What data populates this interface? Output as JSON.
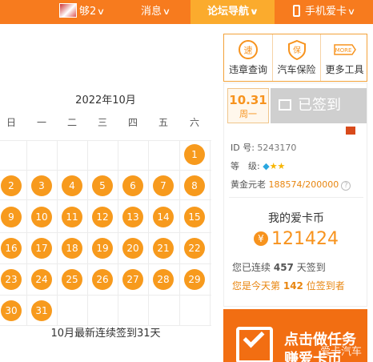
{
  "topnav": {
    "user_label": "够2",
    "messages_label": "消息",
    "forum_nav_label": "论坛导航",
    "mobile_label": "手机爱卡"
  },
  "tools": [
    {
      "icon": "speed-camera-icon",
      "label": "违章查询",
      "glyph": "速"
    },
    {
      "icon": "insurance-icon",
      "label": "汽车保险",
      "glyph": "保"
    },
    {
      "icon": "more-icon",
      "label": "更多工具",
      "glyph": "MORE"
    }
  ],
  "calendar": {
    "title": "2022年10月",
    "weekdays": [
      "日",
      "一",
      "二",
      "三",
      "四",
      "五",
      "六"
    ],
    "signed_days": [
      "1",
      "2",
      "3",
      "4",
      "5",
      "6",
      "7",
      "8",
      "9",
      "10",
      "11",
      "12",
      "13",
      "14",
      "15",
      "16",
      "17",
      "18",
      "19",
      "20",
      "21",
      "22",
      "23",
      "24",
      "25",
      "26",
      "27",
      "28",
      "29",
      "30",
      "31"
    ],
    "footer": "10月最新连续签到31天"
  },
  "sign_panel": {
    "date": "10.31",
    "weekday": "周一",
    "signed_label": "已签到",
    "id_label": "ID 号:",
    "id_value": "5243170",
    "level_label": "等　级:",
    "gold_label": "黄金元老",
    "gold_value": "188574/200000",
    "coin_title": "我的爱卡币",
    "coin_value": "121424",
    "coin_symbol": "¥",
    "streak_prefix": "您已连续",
    "streak_days": "457",
    "streak_suffix": "天签到",
    "rank_prefix": "您是今天第",
    "rank_value": "142",
    "rank_suffix": "位签到者"
  },
  "banner": {
    "line1": "点击做任务",
    "line2": "赚爱卡币"
  },
  "watermark": "爱卡汽车",
  "colors": {
    "accent": "#f77b1e",
    "day_circle": "#f79a1d",
    "signed_button": "#cfcfcf"
  }
}
